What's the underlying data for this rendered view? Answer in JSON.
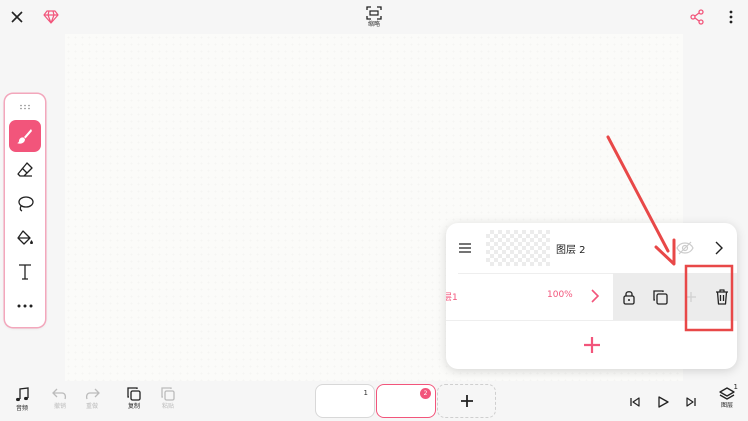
{
  "topbar": {
    "capture_label": "缩略",
    "icons": [
      "close-icon",
      "gem-icon",
      "capture-icon",
      "share-icon",
      "more-vertical-icon"
    ]
  },
  "toolbar": {
    "tools": [
      "brush-icon",
      "eraser-icon",
      "lasso-icon",
      "fill-bucket-icon",
      "text-icon",
      "more-horizontal-icon"
    ],
    "active_tool": "brush"
  },
  "bottombar": {
    "audio_label": "音频",
    "undo_label": "撤销",
    "redo_label": "重做",
    "copy_label": "复制",
    "paste_label": "粘贴",
    "frames": [
      {
        "number": "1",
        "active": false
      },
      {
        "number": "2",
        "active": true
      }
    ],
    "layers_label": "图层",
    "layers_count": "1"
  },
  "layer_panel": {
    "layer_name": "图层 2",
    "opacity_label": "层1",
    "opacity_value": "100%"
  },
  "colors": {
    "accent": "#f2557b",
    "annotation": "#e84848"
  }
}
